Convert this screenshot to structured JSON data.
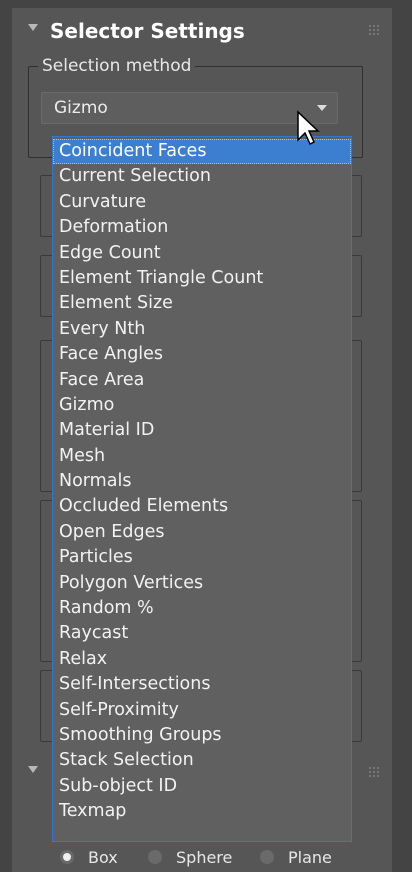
{
  "rollout": {
    "title": "Selector Settings",
    "selection_method_label": "Selection method",
    "dropdown_value": "Gizmo"
  },
  "dropdown_list": {
    "items": [
      "Coincident Faces",
      "Current Selection",
      "Curvature",
      "Deformation",
      "Edge Count",
      "Element Triangle Count",
      "Element Size",
      "Every Nth",
      "Face Angles",
      "Face Area",
      "Gizmo",
      "Material ID",
      "Mesh",
      "Normals",
      "Occluded Elements",
      "Open Edges",
      "Particles",
      "Polygon Vertices",
      "Random %",
      "Raycast",
      "Relax",
      "Self-Intersections",
      "Self-Proximity",
      "Smoothing Groups",
      "Stack Selection",
      "Sub-object ID",
      "Texmap"
    ],
    "highlighted": "Coincident Faces"
  },
  "gizmo_shapes": {
    "options": [
      "Box",
      "Sphere",
      "Plane"
    ],
    "selected": "Box"
  },
  "colors": {
    "panel_bg": "#444444",
    "rollout_bg": "#565656",
    "list_bg": "#606060",
    "highlight": "#3c7fd0",
    "focus_border": "#2d7bd0"
  }
}
